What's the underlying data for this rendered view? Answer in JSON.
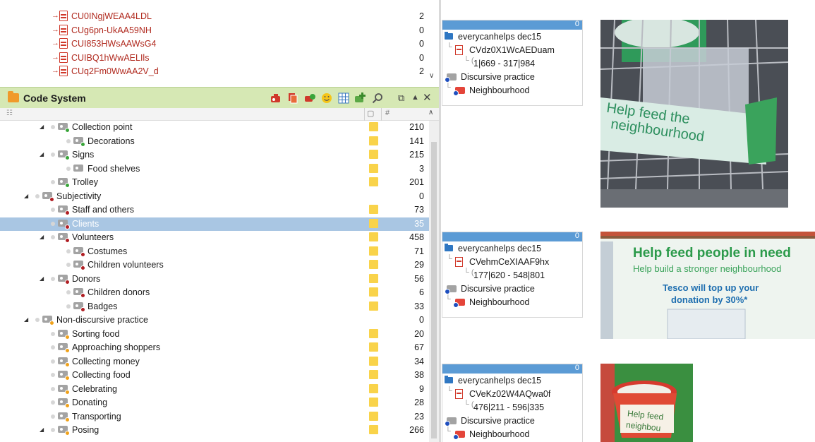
{
  "documents": [
    {
      "name": "CU0INgjWEAA4LDL",
      "count": "2"
    },
    {
      "name": "CUg6pn-UkAA59NH",
      "count": "0"
    },
    {
      "name": "CUI853HWsAAWsG4",
      "count": "0"
    },
    {
      "name": "CUIBQ1hWwAELIls",
      "count": "0"
    },
    {
      "name": "CUq2Fm0WwAA2V_d",
      "count": "2"
    }
  ],
  "code_system": {
    "title": "Code System",
    "colhead_hash": "#",
    "rows": [
      {
        "label": "Collection point",
        "count": "210",
        "level": 2,
        "expander": "open",
        "dot": "#3aa53a",
        "memo": true
      },
      {
        "label": "Decorations",
        "count": "141",
        "level": 3,
        "expander": "none",
        "dot": "#3aa53a",
        "memo": true
      },
      {
        "label": "Signs",
        "count": "215",
        "level": 2,
        "expander": "open",
        "dot": "#3aa53a",
        "memo": true
      },
      {
        "label": "Food shelves",
        "count": "3",
        "level": 3,
        "expander": "none",
        "dot": "",
        "memo": true
      },
      {
        "label": "Trolley",
        "count": "201",
        "level": 2,
        "expander": "none",
        "dot": "#3aa53a",
        "memo": true
      },
      {
        "label": "Subjectivity",
        "count": "0",
        "level": 1,
        "expander": "open",
        "dot": "#b01e23",
        "memo": false
      },
      {
        "label": "Staff and others",
        "count": "73",
        "level": 2,
        "expander": "none",
        "dot": "#b01e23",
        "memo": true
      },
      {
        "label": "Clients",
        "count": "35",
        "level": 2,
        "expander": "none",
        "dot": "#b01e23",
        "memo": true,
        "selected": true
      },
      {
        "label": "Volunteers",
        "count": "458",
        "level": 2,
        "expander": "open",
        "dot": "#b01e23",
        "memo": true
      },
      {
        "label": "Costumes",
        "count": "71",
        "level": 3,
        "expander": "none",
        "dot": "#b01e23",
        "memo": true
      },
      {
        "label": "Children volunteers",
        "count": "29",
        "level": 3,
        "expander": "none",
        "dot": "#b01e23",
        "memo": true
      },
      {
        "label": "Donors",
        "count": "56",
        "level": 2,
        "expander": "open",
        "dot": "#b01e23",
        "memo": true
      },
      {
        "label": "Children donors",
        "count": "6",
        "level": 3,
        "expander": "none",
        "dot": "#b01e23",
        "memo": true
      },
      {
        "label": "Badges",
        "count": "33",
        "level": 3,
        "expander": "none",
        "dot": "#b01e23",
        "memo": true
      },
      {
        "label": "Non-discursive practice",
        "count": "0",
        "level": 1,
        "expander": "open",
        "dot": "#f0a21a",
        "memo": false
      },
      {
        "label": "Sorting food",
        "count": "20",
        "level": 2,
        "expander": "none",
        "dot": "#f0a21a",
        "memo": true
      },
      {
        "label": "Approaching shoppers",
        "count": "67",
        "level": 2,
        "expander": "none",
        "dot": "#f0a21a",
        "memo": true
      },
      {
        "label": "Collecting money",
        "count": "34",
        "level": 2,
        "expander": "none",
        "dot": "#f0a21a",
        "memo": true
      },
      {
        "label": "Collecting food",
        "count": "38",
        "level": 2,
        "expander": "none",
        "dot": "#f0a21a",
        "memo": true
      },
      {
        "label": "Celebrating",
        "count": "9",
        "level": 2,
        "expander": "none",
        "dot": "#f0a21a",
        "memo": true
      },
      {
        "label": "Donating",
        "count": "28",
        "level": 2,
        "expander": "none",
        "dot": "#f0a21a",
        "memo": true
      },
      {
        "label": "Transporting",
        "count": "23",
        "level": 2,
        "expander": "none",
        "dot": "#f0a21a",
        "memo": true
      },
      {
        "label": "Posing",
        "count": "266",
        "level": 2,
        "expander": "open",
        "dot": "#f0a21a",
        "memo": true
      }
    ]
  },
  "snippets": [
    {
      "count": "0",
      "group": "everycanhelps dec15",
      "doc": "CVdz0X1WcAEDuam",
      "range": "1|669 - 317|984",
      "code1": "Discursive practice",
      "code2": "Neighbourhood"
    },
    {
      "count": "0",
      "group": "everycanhelps dec15",
      "doc": "CVehmCeXIAAF9hx",
      "range": "177|620 - 548|801",
      "code1": "Discursive practice",
      "code2": "Neighbourhood"
    },
    {
      "count": "0",
      "group": "everycanhelps dec15",
      "doc": "CVeKz02W4AQwa0f",
      "range": "476|211 - 596|335",
      "code1": "Discursive practice",
      "code2": "Neighbourhood"
    }
  ],
  "photos": {
    "p1_sign_a": "Help feed the",
    "p1_sign_b": "neighbourhood",
    "p2_title": "Help feed people in need",
    "p2_subtitle": "Help build a stronger neighbourhood",
    "p2_offer_a": "Tesco will top up your",
    "p2_offer_b": "donation by 30%*",
    "p3_a": "Help feed",
    "p3_b": "neighbou"
  }
}
